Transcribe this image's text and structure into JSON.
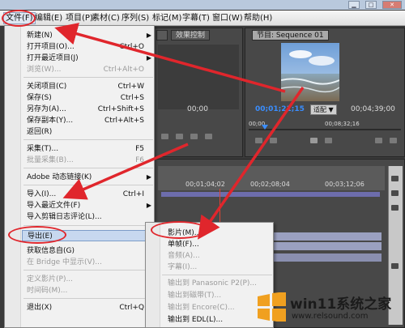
{
  "menubar": {
    "items": [
      "文件(F)",
      "编辑(E)",
      "项目(P)",
      "素材(C)",
      "序列(S)",
      "标记(M)",
      "字幕(T)",
      "窗口(W)",
      "帮助(H)"
    ]
  },
  "tabs": {
    "effects": "效果控制",
    "program": "节目: Sequence 01"
  },
  "monitor": {
    "current_time": "00;01;21;15",
    "fit": "适配",
    "duration": "00;04;39;00",
    "ruler_left": "00;00",
    "ruler_mid": "00;08;32;16",
    "source_time": "00;00"
  },
  "timeline": {
    "ruler": [
      "00;01;04;02",
      "00;02;08;04",
      "00;03;12;06"
    ]
  },
  "file_menu": {
    "items": [
      {
        "label": "新建(N)",
        "shortcut": "",
        "arrow": true,
        "disabled": false
      },
      {
        "label": "打开项目(O)...",
        "shortcut": "Ctrl+O",
        "arrow": false,
        "disabled": false
      },
      {
        "label": "打开最近项目(J)",
        "shortcut": "",
        "arrow": true,
        "disabled": false
      },
      {
        "label": "浏览(W)...",
        "shortcut": "Ctrl+Alt+O",
        "arrow": false,
        "disabled": true
      },
      {
        "label": "关闭项目(C)",
        "shortcut": "Ctrl+W",
        "arrow": false,
        "disabled": false
      },
      {
        "label": "保存(S)",
        "shortcut": "Ctrl+S",
        "arrow": false,
        "disabled": false
      },
      {
        "label": "另存为(A)...",
        "shortcut": "Ctrl+Shift+S",
        "arrow": false,
        "disabled": false
      },
      {
        "label": "保存副本(Y)...",
        "shortcut": "Ctrl+Alt+S",
        "arrow": false,
        "disabled": false
      },
      {
        "label": "返回(R)",
        "shortcut": "",
        "arrow": false,
        "disabled": false
      },
      {
        "label": "采集(T)...",
        "shortcut": "F5",
        "arrow": false,
        "disabled": false
      },
      {
        "label": "批量采集(B)...",
        "shortcut": "F6",
        "arrow": false,
        "disabled": true
      },
      {
        "label": "Adobe 动态链接(K)",
        "shortcut": "",
        "arrow": true,
        "disabled": false
      },
      {
        "label": "导入(I)...",
        "shortcut": "Ctrl+I",
        "arrow": false,
        "disabled": false
      },
      {
        "label": "导入最近文件(F)",
        "shortcut": "",
        "arrow": true,
        "disabled": false
      },
      {
        "label": "导入剪辑日志评论(L)...",
        "shortcut": "",
        "arrow": false,
        "disabled": false
      },
      {
        "label": "导出(E)",
        "shortcut": "",
        "arrow": true,
        "disabled": false
      },
      {
        "label": "获取信息自(G)",
        "shortcut": "",
        "arrow": true,
        "disabled": false
      },
      {
        "label": "在 Bridge 中显示(V)...",
        "shortcut": "",
        "arrow": false,
        "disabled": true
      },
      {
        "label": "定义影片(P)...",
        "shortcut": "",
        "arrow": false,
        "disabled": true
      },
      {
        "label": "时间码(M)...",
        "shortcut": "",
        "arrow": false,
        "disabled": true
      },
      {
        "label": "退出(X)",
        "shortcut": "Ctrl+Q",
        "arrow": false,
        "disabled": false
      }
    ]
  },
  "export_menu": {
    "items": [
      {
        "label": "影片(M)...",
        "disabled": false
      },
      {
        "label": "单帧(F)...",
        "disabled": false
      },
      {
        "label": "音频(A)...",
        "disabled": true
      },
      {
        "label": "字幕(I)...",
        "disabled": true
      },
      {
        "label": "输出到 Panasonic P2(P)...",
        "disabled": true
      },
      {
        "label": "输出到磁带(T)...",
        "disabled": true
      },
      {
        "label": "输出到 Encore(C)...",
        "disabled": true
      },
      {
        "label": "输出到 EDL(L)...",
        "disabled": false
      }
    ]
  },
  "watermark": {
    "title": "win11系统之家",
    "url": "www.relsound.com"
  },
  "colors": {
    "annotation": "#e0262c",
    "timecode": "#3a8eff",
    "menu_highlight": "#c7d8ef"
  }
}
